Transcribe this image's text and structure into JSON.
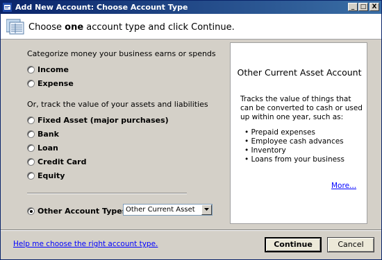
{
  "window": {
    "title": "Add New Account: Choose Account Type",
    "controls": {
      "minimize": "_",
      "maximize": "□",
      "close": "X"
    }
  },
  "header": {
    "prompt_before": "Choose ",
    "prompt_bold": "one",
    "prompt_after": " account type and click Continue."
  },
  "left": {
    "section1_label": "Categorize money your business earns or spends",
    "section2_label": "Or, track the value of your assets and liabilities",
    "options": [
      {
        "label": "Income",
        "checked": false
      },
      {
        "label": "Expense",
        "checked": false
      },
      {
        "label": "Fixed Asset (major purchases)",
        "checked": false
      },
      {
        "label": "Bank",
        "checked": false
      },
      {
        "label": "Loan",
        "checked": false
      },
      {
        "label": "Credit Card",
        "checked": false
      },
      {
        "label": "Equity",
        "checked": false
      }
    ],
    "other": {
      "label": "Other Account Types",
      "checked": true
    },
    "dropdown": {
      "selected": "Other Current Asset"
    }
  },
  "info": {
    "title": "Other Current Asset Account",
    "description": "Tracks the value of things that can be converted to cash or used up within one year, such as:",
    "examples": [
      "Prepaid expenses",
      "Employee cash advances",
      "Inventory",
      "Loans from your business"
    ],
    "more_link": "More..."
  },
  "footer": {
    "help_link": "Help me choose the right account type.",
    "continue_label": "Continue",
    "cancel_label": "Cancel"
  }
}
